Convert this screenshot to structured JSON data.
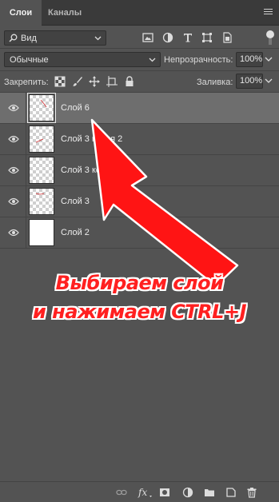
{
  "tabs": [
    {
      "label": "Слои",
      "active": true
    },
    {
      "label": "Каналы",
      "active": false
    }
  ],
  "filter": {
    "kind_label": "Вид",
    "icons": [
      "image-filter-icon",
      "adjustment-filter-icon",
      "type-filter-icon",
      "shape-filter-icon",
      "smart-object-filter-icon"
    ]
  },
  "blend": {
    "mode": "Обычные",
    "opacity_label": "Непрозрачность:",
    "opacity_value": "100%"
  },
  "lock": {
    "label": "Закрепить:",
    "icons": [
      "lock-transparency-icon",
      "lock-pixels-icon",
      "lock-position-icon",
      "lock-artboard-icon",
      "lock-all-icon"
    ],
    "fill_label": "Заливка:",
    "fill_value": "100%"
  },
  "layers": [
    {
      "name": "Слой 6",
      "selected": true,
      "thumb": "transparent"
    },
    {
      "name": "Слой 3 копия 2",
      "selected": false,
      "thumb": "transparent"
    },
    {
      "name": "Слой 3 копия",
      "selected": false,
      "thumb": "transparent"
    },
    {
      "name": "Слой 3",
      "selected": false,
      "thumb": "transparent"
    },
    {
      "name": "Слой 2",
      "selected": false,
      "thumb": "white"
    }
  ],
  "bottom_bar": [
    "link-layers-icon",
    "fx-icon",
    "add-mask-icon",
    "adjustment-layer-icon",
    "new-group-icon",
    "new-layer-icon",
    "delete-icon"
  ],
  "annotation": {
    "line1": "Выбираем слой",
    "line2": "и нажимаем CTRL+J",
    "color": "#ff2020"
  }
}
